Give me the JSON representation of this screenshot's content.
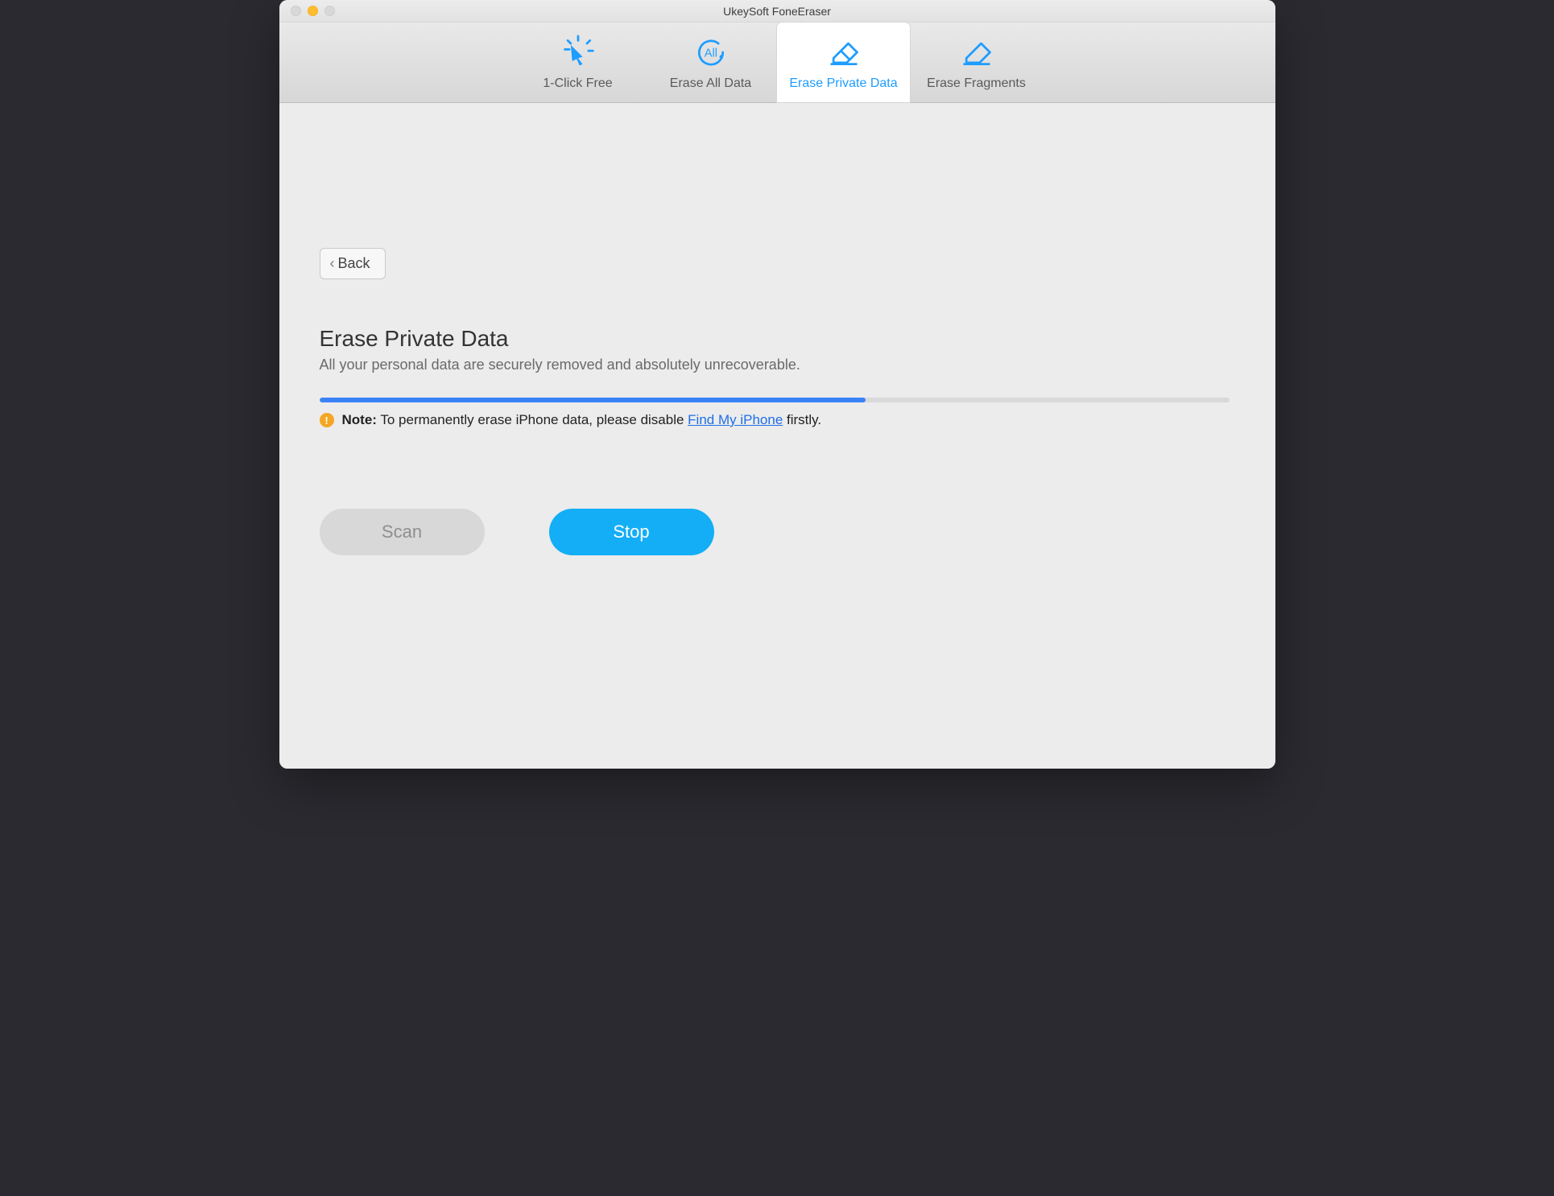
{
  "window": {
    "title": "UkeySoft FoneEraser"
  },
  "tabs": [
    {
      "label": "1-Click Free",
      "icon": "click"
    },
    {
      "label": "Erase All Data",
      "icon": "all"
    },
    {
      "label": "Erase Private Data",
      "icon": "eraser",
      "active": true
    },
    {
      "label": "Erase Fragments",
      "icon": "eraser"
    }
  ],
  "back": {
    "label": "Back"
  },
  "page": {
    "title": "Erase Private Data",
    "subtitle": "All your personal data are securely removed and absolutely unrecoverable."
  },
  "progress": {
    "percent": 60
  },
  "note": {
    "label": "Note:",
    "before": " To permanently erase iPhone data, please disable ",
    "link": "Find My iPhone",
    "after": " firstly."
  },
  "buttons": {
    "scan": "Scan",
    "stop": "Stop"
  }
}
